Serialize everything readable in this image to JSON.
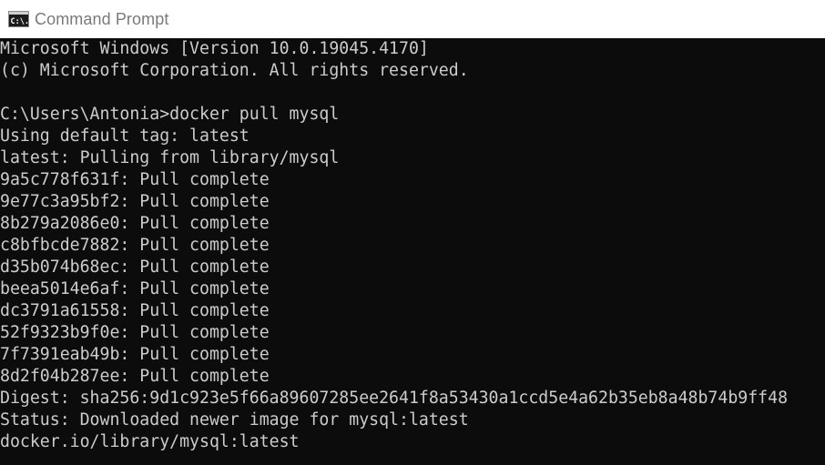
{
  "window": {
    "title": "Command Prompt",
    "icon": "cmd-icon",
    "icon_text": "C:\\."
  },
  "colors": {
    "console_background": "#0c0c0c",
    "console_text": "#cccccc",
    "titlebar_background": "#ffffff",
    "title_text": "#7a7a7a"
  },
  "console": {
    "lines": [
      "Microsoft Windows [Version 10.0.19045.4170]",
      "(c) Microsoft Corporation. All rights reserved.",
      "",
      "C:\\Users\\Antonia>docker pull mysql",
      "Using default tag: latest",
      "latest: Pulling from library/mysql",
      "9a5c778f631f: Pull complete",
      "9e77c3a95bf2: Pull complete",
      "8b279a2086e0: Pull complete",
      "c8bfbcde7882: Pull complete",
      "d35b074b68ec: Pull complete",
      "beea5014e6af: Pull complete",
      "dc3791a61558: Pull complete",
      "52f9323b9f0e: Pull complete",
      "7f7391eab49b: Pull complete",
      "8d2f04b287ee: Pull complete",
      "Digest: sha256:9d1c923e5f66a89607285ee2641f8a53430a1ccd5e4a62b35eb8a48b74b9ff48",
      "Status: Downloaded newer image for mysql:latest",
      "docker.io/library/mysql:latest"
    ]
  }
}
